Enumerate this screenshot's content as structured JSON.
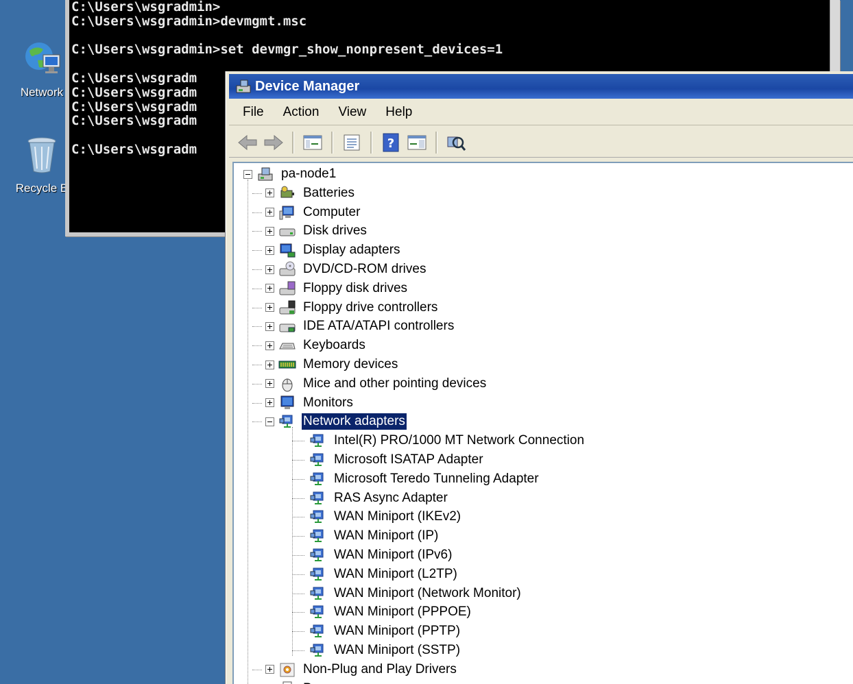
{
  "desktop": {
    "network_label": "Network",
    "recycle_label": "Recycle B"
  },
  "console": {
    "lines": [
      "C:\\Users\\wsgradmin>",
      "C:\\Users\\wsgradmin>devmgmt.msc",
      "",
      "C:\\Users\\wsgradmin>set devmgr_show_nonpresent_devices=1",
      "",
      "C:\\Users\\wsgradm",
      "C:\\Users\\wsgradm",
      "C:\\Users\\wsgradm",
      "C:\\Users\\wsgradm",
      "",
      "C:\\Users\\wsgradm"
    ]
  },
  "device_manager": {
    "title": "Device Manager",
    "menu": [
      "File",
      "Action",
      "View",
      "Help"
    ],
    "toolbar_icons": [
      "back-arrow-icon",
      "forward-arrow-icon",
      "show-hide-tree-icon",
      "properties-icon",
      "help-icon",
      "action-pane-icon",
      "scan-hardware-icon"
    ],
    "root": "pa-node1",
    "categories": [
      {
        "label": "Batteries",
        "icon": "battery-icon",
        "expanded": false
      },
      {
        "label": "Computer",
        "icon": "computer-icon",
        "expanded": false
      },
      {
        "label": "Disk drives",
        "icon": "disk-drive-icon",
        "expanded": false
      },
      {
        "label": "Display adapters",
        "icon": "display-adapter-icon",
        "expanded": false
      },
      {
        "label": "DVD/CD-ROM drives",
        "icon": "dvd-drive-icon",
        "expanded": false
      },
      {
        "label": "Floppy disk drives",
        "icon": "floppy-disk-icon",
        "expanded": false
      },
      {
        "label": "Floppy drive controllers",
        "icon": "floppy-controller-icon",
        "expanded": false
      },
      {
        "label": "IDE ATA/ATAPI controllers",
        "icon": "ide-controller-icon",
        "expanded": false
      },
      {
        "label": "Keyboards",
        "icon": "keyboard-icon",
        "expanded": false
      },
      {
        "label": "Memory devices",
        "icon": "memory-icon",
        "expanded": false
      },
      {
        "label": "Mice and other pointing devices",
        "icon": "mouse-icon",
        "expanded": false
      },
      {
        "label": "Monitors",
        "icon": "monitor-icon",
        "expanded": false
      },
      {
        "label": "Network adapters",
        "icon": "network-adapter-icon",
        "expanded": true,
        "selected": true,
        "children": [
          "Intel(R) PRO/1000 MT Network Connection",
          "Microsoft ISATAP Adapter",
          "Microsoft Teredo Tunneling Adapter",
          "RAS Async Adapter",
          "WAN Miniport (IKEv2)",
          "WAN Miniport (IP)",
          "WAN Miniport (IPv6)",
          "WAN Miniport (L2TP)",
          "WAN Miniport (Network Monitor)",
          "WAN Miniport (PPPOE)",
          "WAN Miniport (PPTP)",
          "WAN Miniport (SSTP)"
        ]
      },
      {
        "label": "Non-Plug and Play Drivers",
        "icon": "driver-gear-icon",
        "expanded": false
      },
      {
        "label": "P",
        "icon": "printer-icon",
        "expanded": false
      }
    ]
  }
}
